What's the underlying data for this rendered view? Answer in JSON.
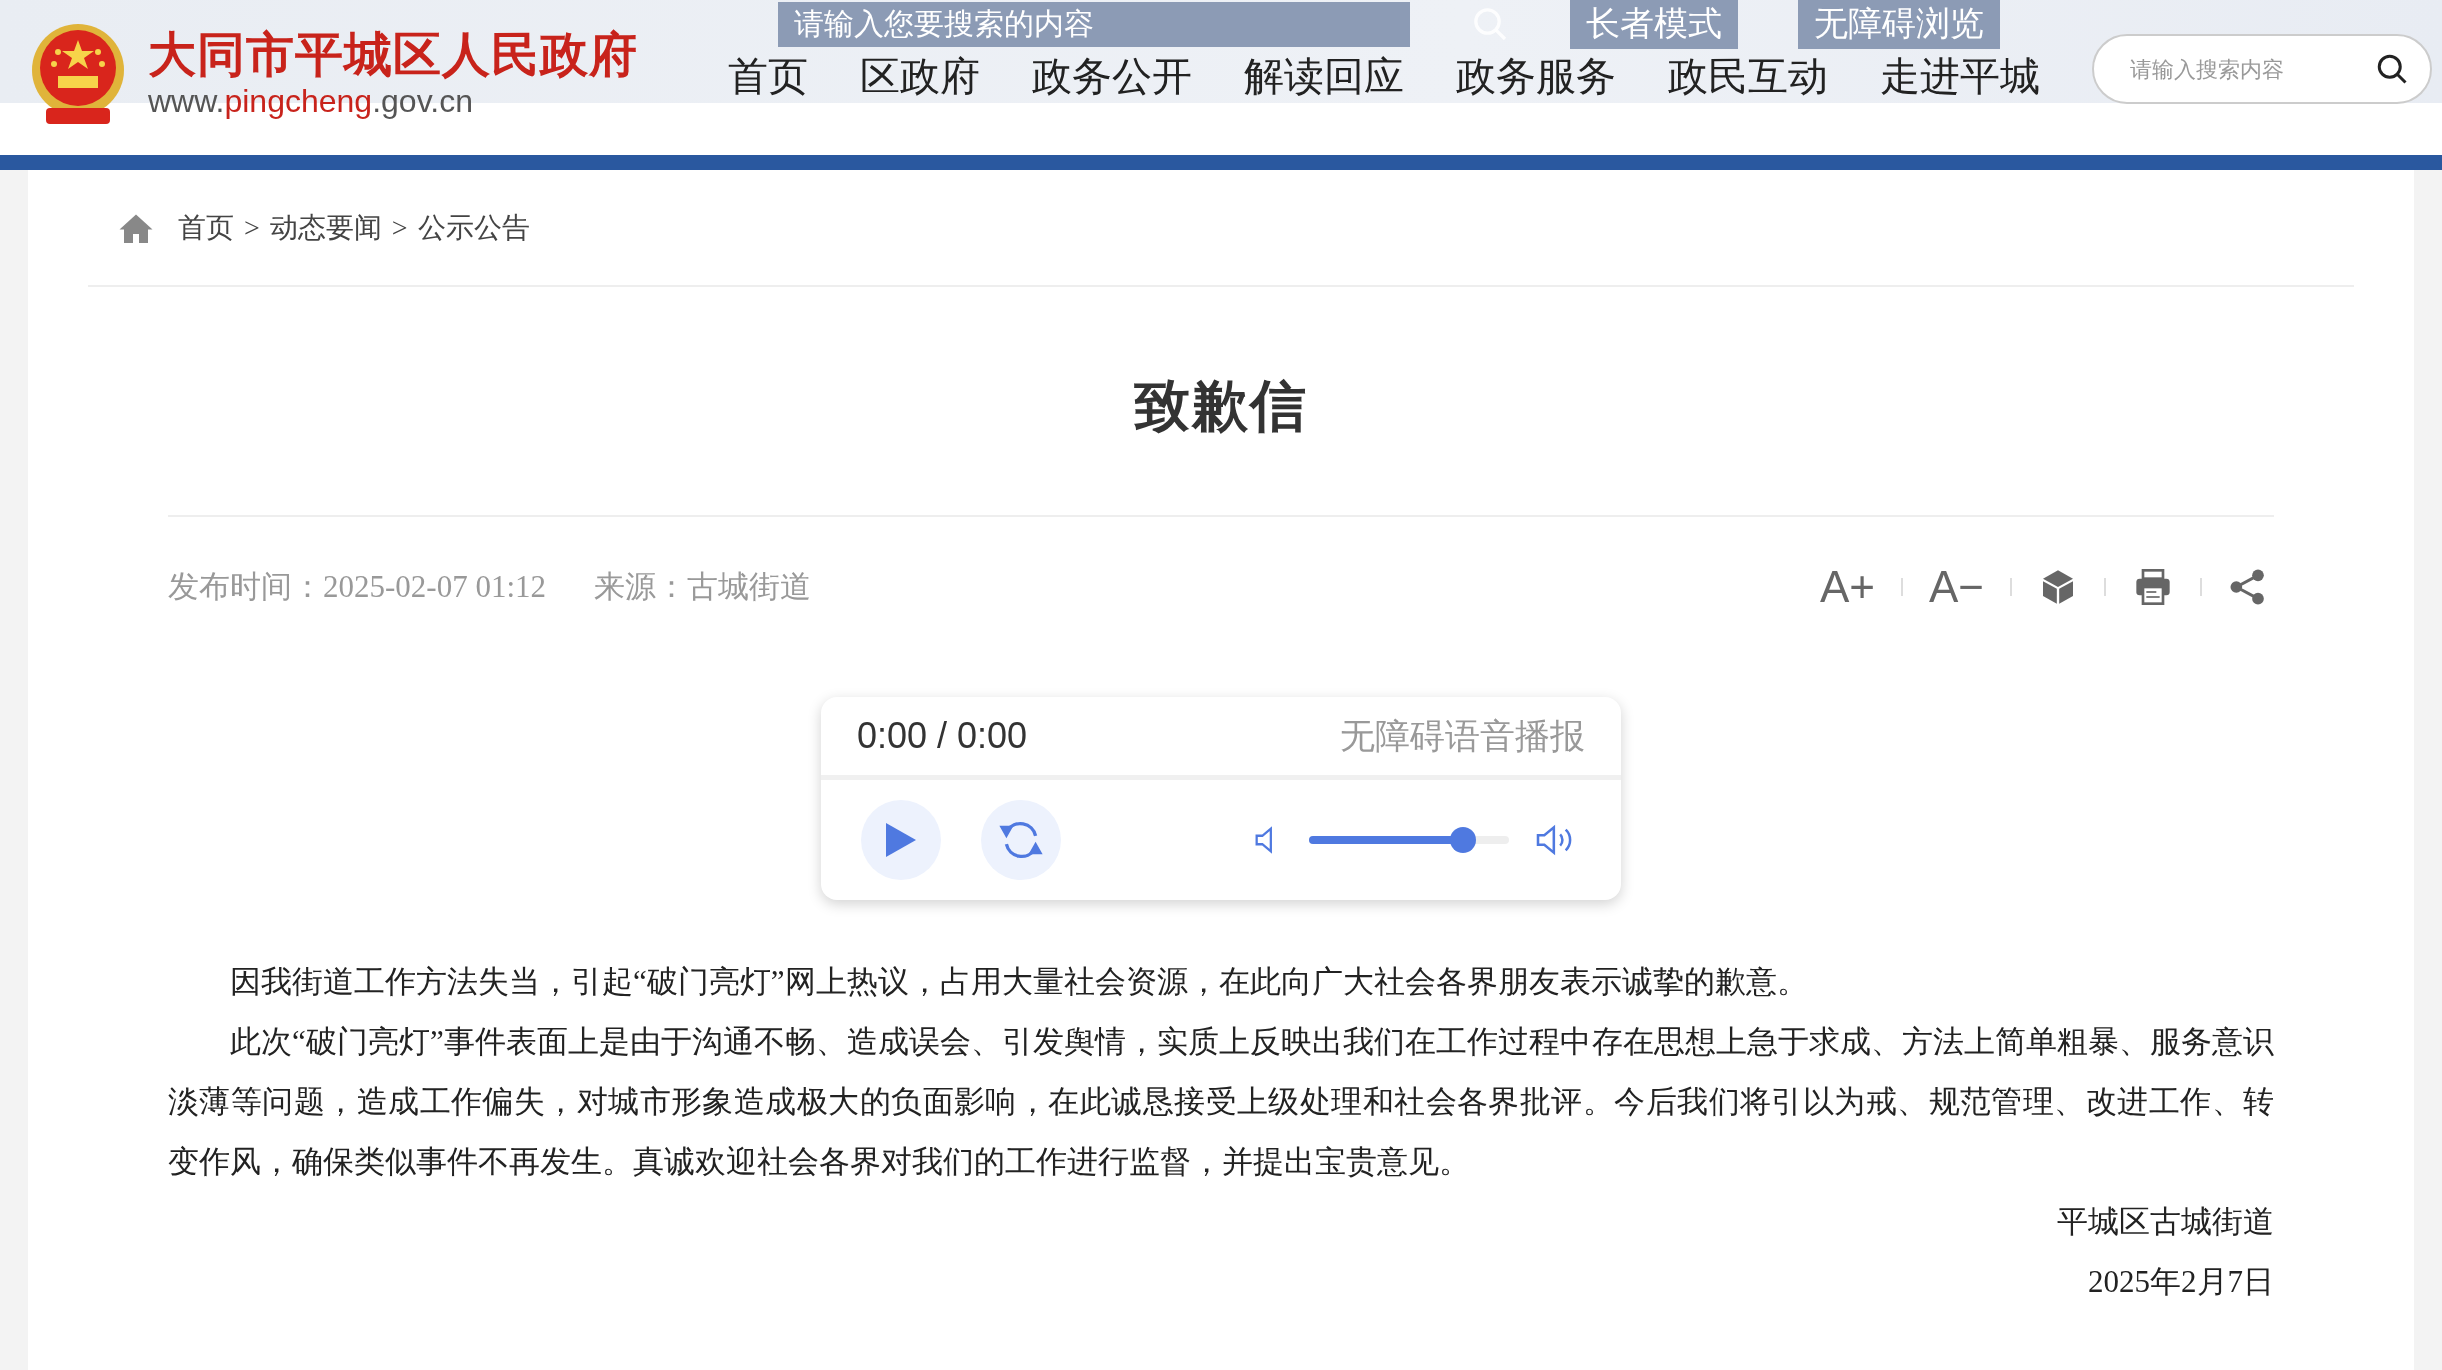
{
  "overlay_bar": {
    "search_placeholder": "请输入您要搜索的内容",
    "links": [
      "长者模式",
      "无障碍浏览"
    ]
  },
  "header": {
    "site_name": "大同市平城区人民政府",
    "url_parts": [
      {
        "text": "www.",
        "accent": false
      },
      {
        "text": "pingcheng",
        "accent": true
      },
      {
        "text": ".gov.cn",
        "accent": false
      }
    ],
    "nav": [
      {
        "label": "首页",
        "selected": false
      },
      {
        "label": "区政府",
        "selected": false
      },
      {
        "label": "政务公开",
        "selected": false
      },
      {
        "label": "解读回应",
        "selected": false
      },
      {
        "label": "政务服务",
        "selected": false
      },
      {
        "label": "政民互动",
        "selected": false
      },
      {
        "label": "走进平城",
        "selected": false
      }
    ],
    "search": {
      "placeholder": "请输入搜索内容"
    }
  },
  "breadcrumb": [
    "首页",
    "动态要闻",
    "公示公告"
  ],
  "breadcrumb_separator": ">",
  "article": {
    "title": "致歉信",
    "published": "发布时间：2025-02-07 01:12",
    "source": "来源：古城街道",
    "tools": [
      {
        "kind": "text",
        "label": "A+"
      },
      {
        "kind": "text",
        "label": "A−"
      },
      {
        "kind": "cube"
      },
      {
        "kind": "print"
      },
      {
        "kind": "share"
      }
    ],
    "player": {
      "time": "0:00 / 0:00",
      "label": "无障碍语音播报",
      "level": 0.77
    },
    "paragraphs": [
      "因我街道工作方法失当，引起“破门亮灯”网上热议，占用大量社会资源，在此向广大社会各界朋友表示诚挚的歉意。",
      "此次“破门亮灯”事件表面上是由于沟通不畅、造成误会、引发舆情，实质上反映出我们在工作过程中存在思想上急于求成、方法上简单粗暴、服务意识淡薄等问题，造成工作偏失，对城市形象造成极大的负面影响，在此诚恳接受上级处理和社会各界批评。今后我们将引以为戒、规范管理、改进工作、转变作风，确保类似事件不再发生。真诚欢迎社会各界对我们的工作进行监督，并提出宝贵意见。"
    ],
    "signature": "平城区古城街道",
    "date": "2025年2月7日"
  }
}
